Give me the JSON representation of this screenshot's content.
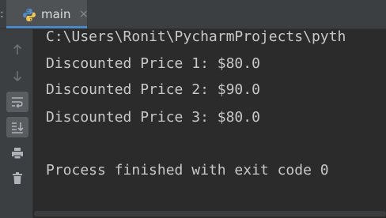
{
  "tabbar": {
    "prefix": ":",
    "tab": {
      "label": "main",
      "icon": "python-icon",
      "close_glyph": "×"
    }
  },
  "sidebar": {
    "buttons": [
      {
        "icon": "arrow-up-icon"
      },
      {
        "icon": "arrow-down-icon"
      },
      {
        "icon": "soft-wrap-icon",
        "active": true
      },
      {
        "icon": "scroll-to-end-icon",
        "active": true
      },
      {
        "icon": "print-icon"
      },
      {
        "icon": "trash-icon"
      }
    ]
  },
  "console": {
    "lines": [
      "C:\\Users\\Ronit\\PycharmProjects\\pyth",
      "Discounted Price 1: $80.0",
      "Discounted Price 2: $90.0",
      "Discounted Price 3: $80.0",
      "",
      "Process finished with exit code 0"
    ]
  },
  "colors": {
    "background": "#2b2b2b",
    "panel": "#3c3f41",
    "text": "#c8c8c8",
    "tab_underline": "#4a88c7"
  }
}
